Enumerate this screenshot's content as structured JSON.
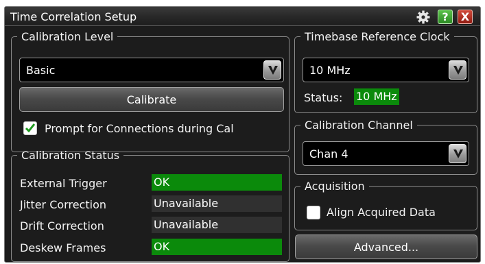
{
  "window": {
    "title": "Time Correlation Setup",
    "icons": [
      "gear-icon",
      "help-icon",
      "close-icon"
    ],
    "help_glyph": "?",
    "close_glyph": "X"
  },
  "calibration_level": {
    "legend": "Calibration Level",
    "selected": "Basic",
    "calibrate_label": "Calibrate",
    "prompt_checked": true,
    "prompt_label": "Prompt for Connections during Cal"
  },
  "calibration_status": {
    "legend": "Calibration Status",
    "rows": [
      {
        "label": "External Trigger",
        "value": "OK",
        "state": "ok"
      },
      {
        "label": "Jitter Correction",
        "value": "Unavailable",
        "state": "unavailable"
      },
      {
        "label": "Drift Correction",
        "value": "Unavailable",
        "state": "unavailable"
      },
      {
        "label": "Deskew Frames",
        "value": "OK",
        "state": "ok"
      }
    ]
  },
  "timebase": {
    "legend": "Timebase Reference Clock",
    "selected": "10 MHz",
    "status_label": "Status:",
    "status_value": "10 MHz"
  },
  "calibration_channel": {
    "legend": "Calibration Channel",
    "selected": "Chan 4"
  },
  "acquisition": {
    "legend": "Acquisition",
    "align_checked": false,
    "align_label": "Align Acquired Data"
  },
  "advanced_label": "Advanced...",
  "colors": {
    "ok": "#0b8a0b",
    "unavailable": "#303030",
    "background": "#1c1c1c",
    "help": "#2c8a24",
    "close": "#b02a1c"
  }
}
